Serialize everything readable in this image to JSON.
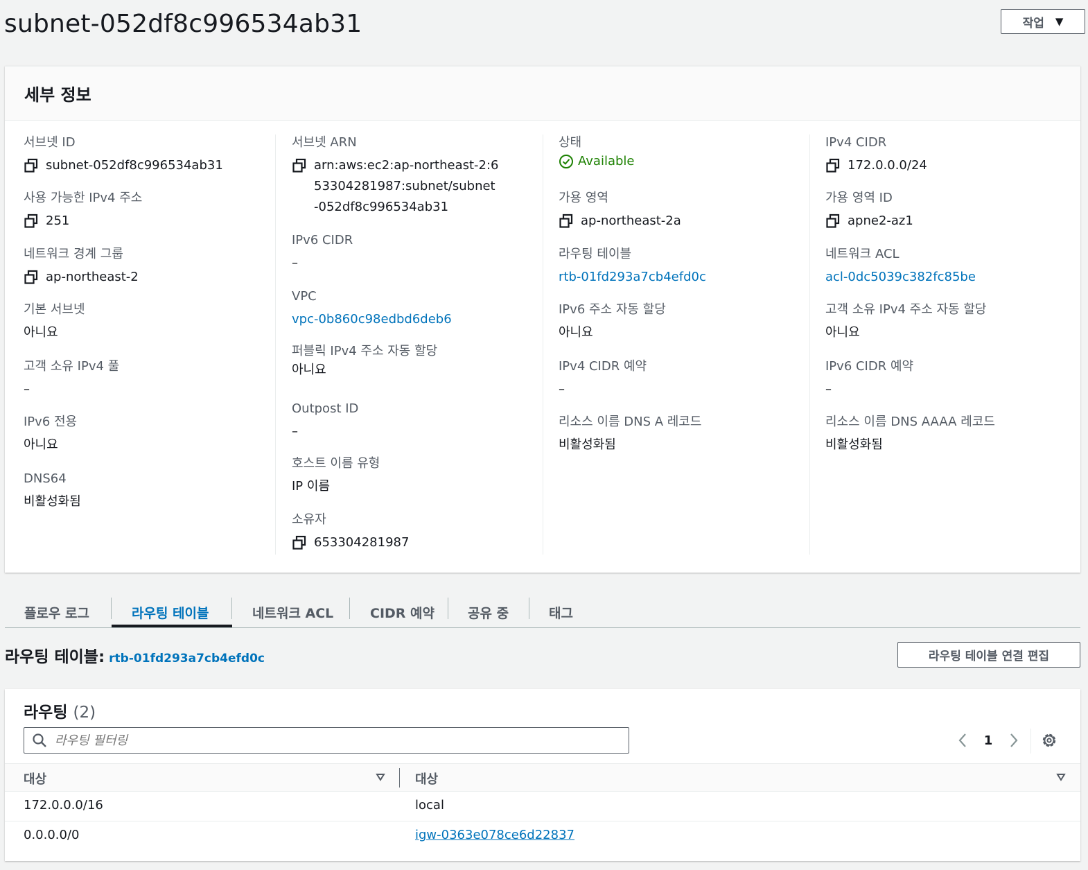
{
  "page": {
    "title": "subnet-052df8c996534ab31"
  },
  "actions": {
    "label": "작업"
  },
  "details": {
    "title": "세부 정보",
    "subnet_id": {
      "label": "서브넷 ID",
      "value": "subnet-052df8c996534ab31"
    },
    "available_ipv4": {
      "label": "사용 가능한 IPv4 주소",
      "value": "251"
    },
    "network_border_group": {
      "label": "네트워크 경계 그룹",
      "value": "ap-northeast-2"
    },
    "default_subnet": {
      "label": "기본 서브넷",
      "value": "아니요"
    },
    "customer_owned_pool": {
      "label": "고객 소유 IPv4 풀",
      "value": "–"
    },
    "ipv6_only": {
      "label": "IPv6 전용",
      "value": "아니요"
    },
    "dns64": {
      "label": "DNS64",
      "value": "비활성화됨"
    },
    "subnet_arn": {
      "label": "서브넷 ARN",
      "value": "arn:aws:ec2:ap-northeast-2:653304281987:subnet/subnet-052df8c996534ab31"
    },
    "ipv6_cidr": {
      "label": "IPv6 CIDR",
      "value": "–"
    },
    "vpc": {
      "label": "VPC",
      "value": "vpc-0b860c98edbd6deb6"
    },
    "public_ipv4_auto": {
      "label": "퍼블릭 IPv4 주소 자동 할당",
      "value": "아니요"
    },
    "outpost_id": {
      "label": "Outpost ID",
      "value": "–"
    },
    "hostname_type": {
      "label": "호스트 이름 유형",
      "value": "IP 이름"
    },
    "owner": {
      "label": "소유자",
      "value": "653304281987"
    },
    "state": {
      "label": "상태",
      "value": "Available",
      "color": "#1d8102"
    },
    "availability_zone": {
      "label": "가용 영역",
      "value": "ap-northeast-2a"
    },
    "route_table": {
      "label": "라우팅 테이블",
      "value": "rtb-01fd293a7cb4efd0c"
    },
    "ipv6_auto": {
      "label": "IPv6 주소 자동 할당",
      "value": "아니요"
    },
    "ipv4_cidr_reservation": {
      "label": "IPv4 CIDR 예약",
      "value": "–"
    },
    "dns_a_record": {
      "label": "리소스 이름 DNS A 레코드",
      "value": "비활성화됨"
    },
    "ipv4_cidr": {
      "label": "IPv4 CIDR",
      "value": "172.0.0.0/24"
    },
    "az_id": {
      "label": "가용 영역 ID",
      "value": "apne2-az1"
    },
    "network_acl": {
      "label": "네트워크 ACL",
      "value": "acl-0dc5039c382fc85be"
    },
    "customer_owned_auto": {
      "label": "고객 소유 IPv4 주소 자동 할당",
      "value": "아니요"
    },
    "ipv6_cidr_reservation": {
      "label": "IPv6 CIDR 예약",
      "value": "–"
    },
    "dns_aaaa_record": {
      "label": "리소스 이름 DNS AAAA 레코드",
      "value": "비활성화됨"
    }
  },
  "tabs": [
    {
      "label": "플로우 로그"
    },
    {
      "label": "라우팅 테이블",
      "active": true
    },
    {
      "label": "네트워크 ACL"
    },
    {
      "label": "CIDR 예약"
    },
    {
      "label": "공유 중"
    },
    {
      "label": "태그"
    }
  ],
  "route_table_section": {
    "heading": "라우팅 테이블:",
    "id": "rtb-01fd293a7cb4efd0c",
    "edit_label": "라우팅 테이블 연결 편집"
  },
  "routes": {
    "title": "라우팅",
    "count": "(2)",
    "filter_placeholder": "라우팅 필터링",
    "page": "1",
    "columns": [
      "대상",
      "대상"
    ],
    "rows": [
      {
        "destination": "172.0.0.0/16",
        "target": "local"
      },
      {
        "destination": "0.0.0.0/0",
        "target": "igw-0363e078ce6d22837"
      }
    ]
  },
  "icons": [
    "copy-icon",
    "check-circle-icon",
    "search-icon",
    "chevron-left-icon",
    "chevron-right-icon",
    "gear-icon",
    "sort-down-icon",
    "caret-down-icon"
  ],
  "colors": {
    "link": "#0073bb",
    "success": "#1d8102",
    "text": "#16191f",
    "muted": "#545b64"
  }
}
